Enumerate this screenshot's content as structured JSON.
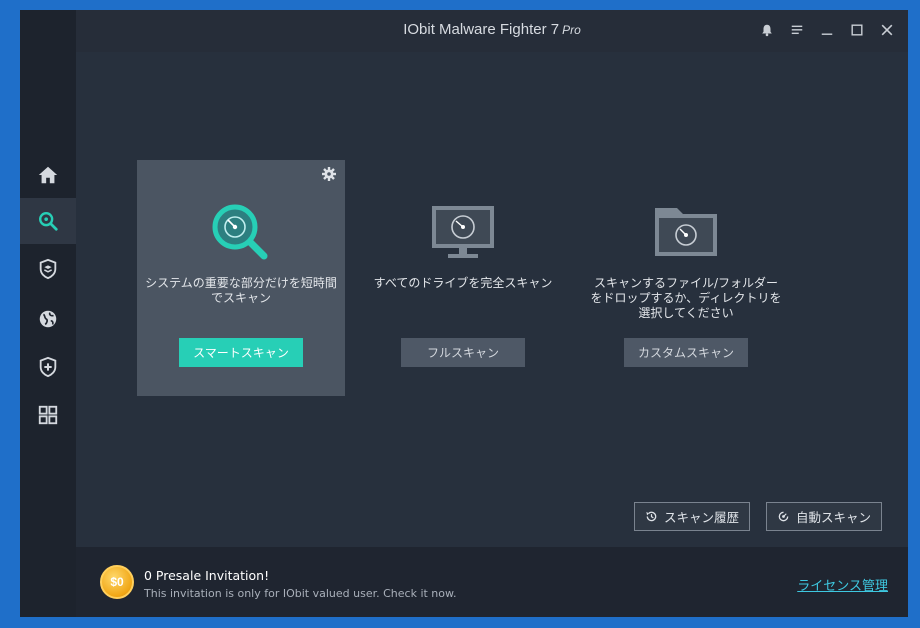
{
  "app": {
    "title": "IObit Malware Fighter 7",
    "edition": "Pro"
  },
  "sidebar": {
    "items": [
      {
        "name": "home",
        "icon": "home-icon",
        "active": false
      },
      {
        "name": "scan",
        "icon": "search-icon",
        "active": true
      },
      {
        "name": "protection",
        "icon": "layers-shield-icon",
        "active": false
      },
      {
        "name": "browser",
        "icon": "globe-icon",
        "active": false
      },
      {
        "name": "action-center",
        "icon": "shield-plus-icon",
        "active": false
      },
      {
        "name": "tools",
        "icon": "grid-icon",
        "active": false
      }
    ]
  },
  "scans": {
    "smart": {
      "description": "システムの重要な部分だけを短時間でスキャン",
      "button": "スマートスキャン"
    },
    "full": {
      "description": "すべてのドライブを完全スキャン",
      "button": "フルスキャン"
    },
    "custom": {
      "description": "スキャンするファイル/フォルダーをドロップするか、ディレクトリを選択してください",
      "button": "カスタムスキャン"
    }
  },
  "actions": {
    "history": "スキャン履歴",
    "auto": "自動スキャン"
  },
  "promo": {
    "coin": "$0",
    "title": "0 Presale Invitation!",
    "subtitle": "This invitation is only for IObit valued user. Check it now.",
    "link": "ライセンス管理"
  },
  "colors": {
    "accent": "#27cfb6",
    "link": "#3ec8e0",
    "background": "#252c38",
    "frame": "#1f6fc9"
  }
}
